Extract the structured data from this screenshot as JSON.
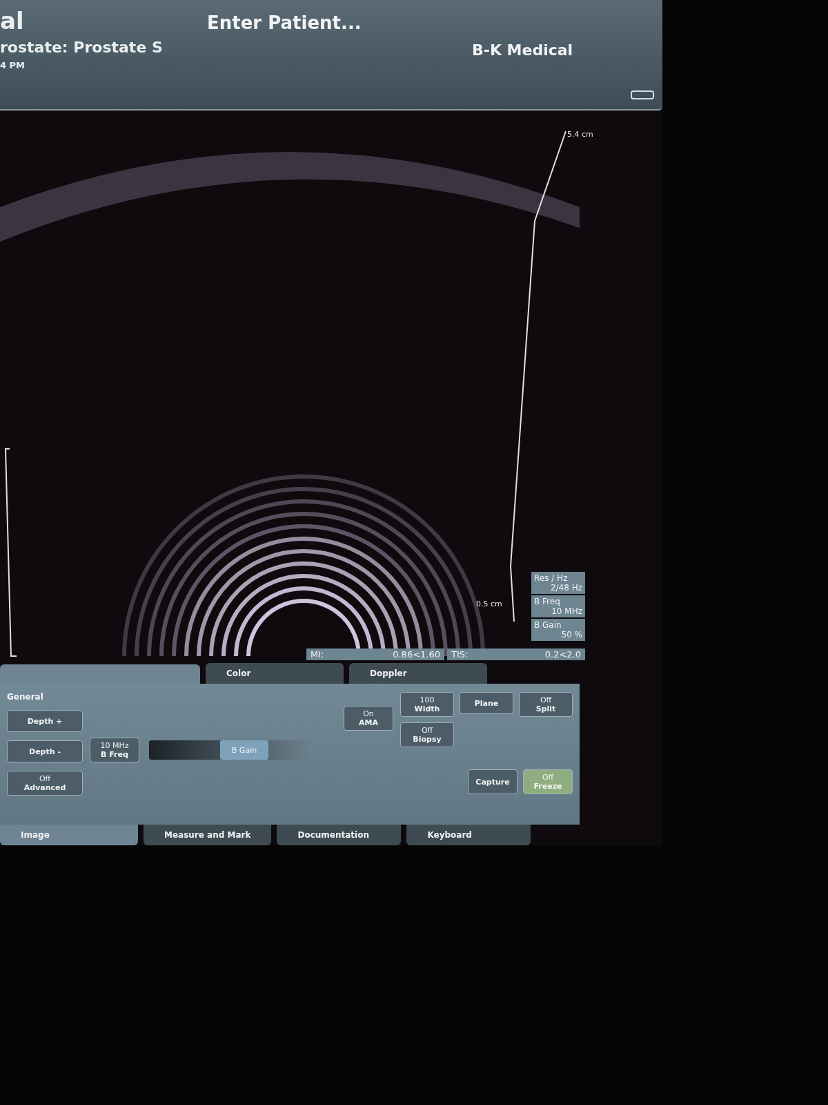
{
  "header": {
    "title": "al",
    "patient": "Enter Patient...",
    "brand": "B-K Medical",
    "exam": "rostate: Prostate S",
    "time": "4 PM"
  },
  "image": {
    "depth_top": "5.4 cm",
    "depth_scale": "0.5 cm"
  },
  "readouts": [
    {
      "label": "Res / Hz",
      "value": "2/48 Hz"
    },
    {
      "label": "B Freq",
      "value": "10 MHz"
    },
    {
      "label": "B Gain",
      "value": "50 %"
    }
  ],
  "indices": [
    {
      "label": "MI:",
      "value": "0.86<1.60"
    },
    {
      "label": "TIS:",
      "value": "0.2<2.0"
    }
  ],
  "top_tabs": [
    {
      "label": "Color",
      "selected": false
    },
    {
      "label": "Doppler",
      "selected": false
    }
  ],
  "panel": {
    "title": "General",
    "left_buttons": [
      {
        "label": "Depth +",
        "on": false
      },
      {
        "label": "Depth -",
        "on": false
      },
      {
        "value": "Off",
        "label": "Advanced",
        "on": false
      }
    ],
    "freq_button": {
      "value": "10 MHz",
      "label": "B Freq",
      "on": false
    },
    "gain_slider": {
      "label": "B Gain",
      "level": 0.6
    },
    "ama_button": {
      "value": "On",
      "label": "AMA",
      "on": false
    },
    "right_buttons": [
      {
        "value": "100",
        "label": "Width",
        "on": false
      },
      {
        "label": "Plane",
        "on": false
      },
      {
        "value": "Off",
        "label": "Split",
        "on": false
      },
      {
        "value": "Off",
        "label": "Biopsy",
        "on": false
      },
      {
        "label": "Capture",
        "on": false
      },
      {
        "value": "Off",
        "label": "Freeze",
        "on": true
      }
    ]
  },
  "bottom_tabs": [
    {
      "label": "Image",
      "selected": true
    },
    {
      "label": "Measure and Mark",
      "selected": false
    },
    {
      "label": "Documentation",
      "selected": false
    },
    {
      "label": "Keyboard",
      "selected": false
    }
  ]
}
